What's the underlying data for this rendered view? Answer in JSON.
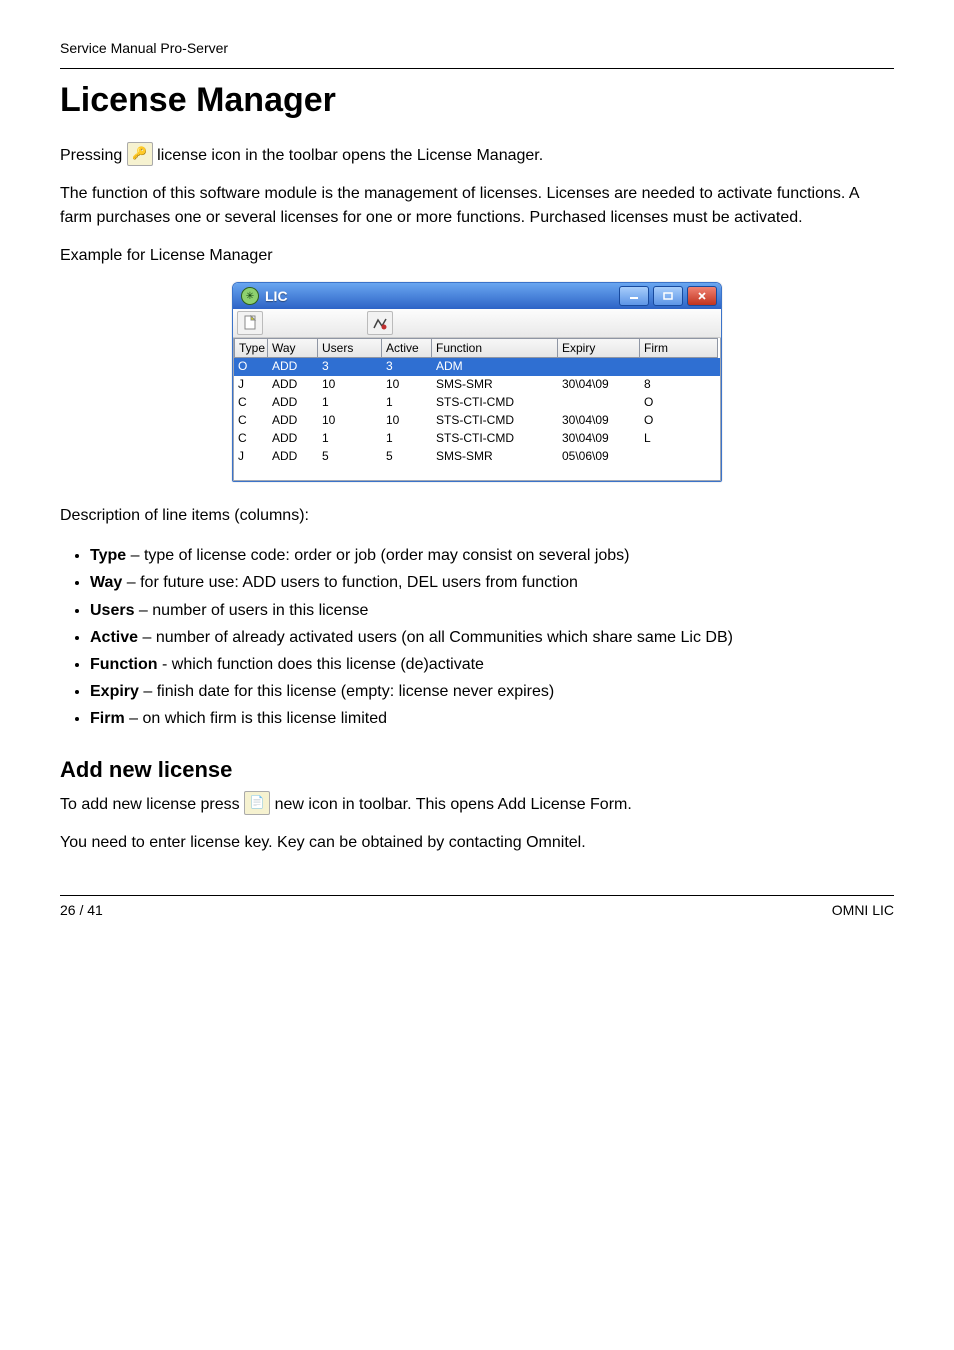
{
  "header": {
    "line": "Service Manual Pro-Server"
  },
  "title": "License Manager",
  "intro": {
    "p1a": "Pressing ",
    "p1b": " license icon in the toolbar opens the License Manager.",
    "p2": "The function of this software module is the management of licenses. Licenses are needed to activate functions. A farm purchases one or several licenses for one or more functions. Purchased licenses must be activated.",
    "p3": "Example for License Manager"
  },
  "window": {
    "title": "LIC",
    "toolbar": {
      "new": "new",
      "tool2": "tool"
    },
    "columns": [
      "Type",
      "Way",
      "Users",
      "Active",
      "Function",
      "Expiry",
      "Firm"
    ],
    "rows": [
      {
        "type": "O",
        "way": "ADD",
        "users": "3",
        "active": "3",
        "func": "ADM",
        "exp": "",
        "firm": "",
        "selected": true
      },
      {
        "type": "J",
        "way": "ADD",
        "users": "10",
        "active": "10",
        "func": "SMS-SMR",
        "exp": "30\\04\\09",
        "firm": "8"
      },
      {
        "type": "C",
        "way": "ADD",
        "users": "1",
        "active": "1",
        "func": "STS-CTI-CMD",
        "exp": "",
        "firm": "O"
      },
      {
        "type": "C",
        "way": "ADD",
        "users": "10",
        "active": "10",
        "func": "STS-CTI-CMD",
        "exp": "30\\04\\09",
        "firm": "O"
      },
      {
        "type": "C",
        "way": "ADD",
        "users": "1",
        "active": "1",
        "func": "STS-CTI-CMD",
        "exp": "30\\04\\09",
        "firm": "L"
      },
      {
        "type": "J",
        "way": "ADD",
        "users": "5",
        "active": "5",
        "func": "SMS-SMR",
        "exp": "05\\06\\09",
        "firm": ""
      }
    ]
  },
  "desc": {
    "lead": "Description of line items (columns):",
    "items": [
      {
        "k": "Type",
        "v": " – type of license code: order or job (order may consist on several jobs)"
      },
      {
        "k": "Way",
        "v": " – for future use: ADD users to function, DEL users from function"
      },
      {
        "k": "Users",
        "v": " – number of users in this license"
      },
      {
        "k": "Active",
        "v": " – number of already activated users (on all Communities which share same Lic DB)"
      },
      {
        "k": "Function",
        "v": " - which function does this license (de)activate"
      },
      {
        "k": "Expiry",
        "v": " – finish date for this license (empty: license never expires)"
      },
      {
        "k": "Firm",
        "v": " – on which firm is this license limited"
      }
    ]
  },
  "add": {
    "heading": "Add new license",
    "p1a": "To add new license press ",
    "p1b": " new icon in toolbar. This opens Add License Form.",
    "p2": "You need to enter license key. Key can be obtained by contacting Omnitel."
  },
  "footer": {
    "left": "26 / 41",
    "right": "OMNI LIC"
  }
}
